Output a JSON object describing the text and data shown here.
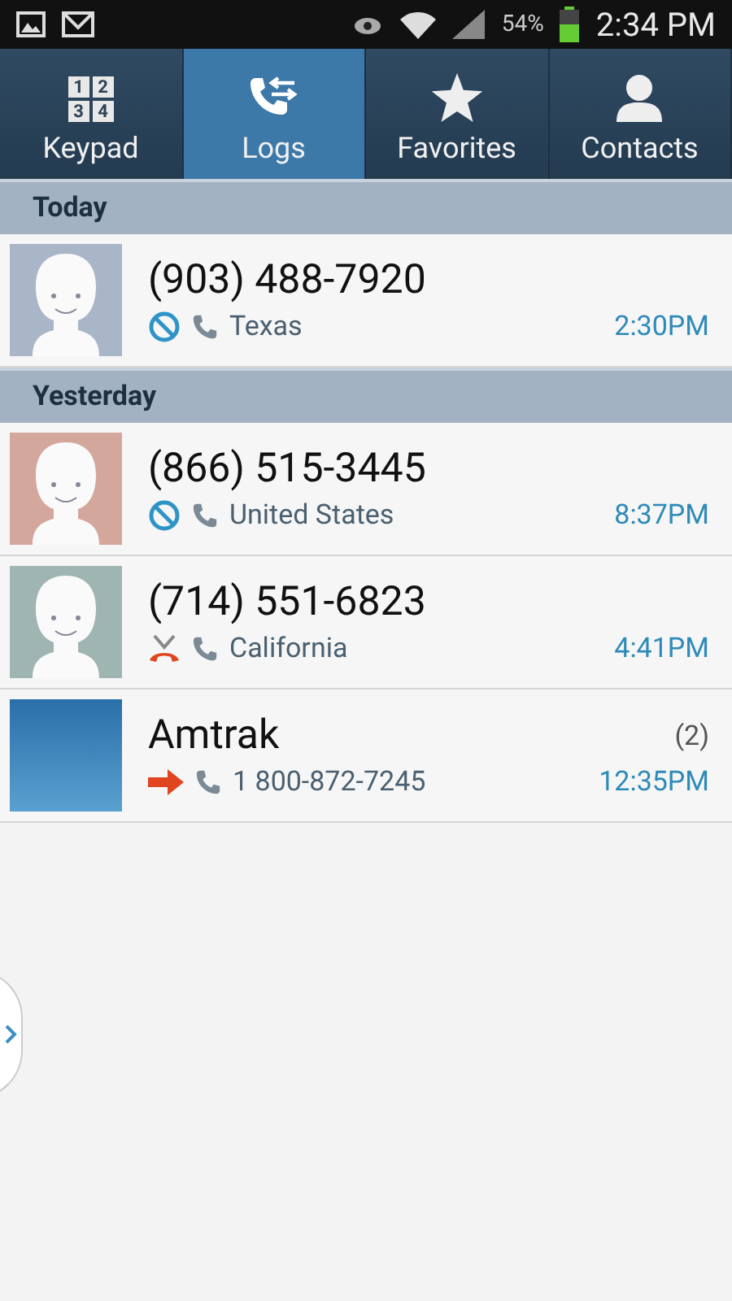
{
  "status_bar": {
    "battery_text": "54%",
    "time": "2:34 PM"
  },
  "tabs": [
    {
      "label": "Keypad",
      "selected": false,
      "kind": "keypad",
      "icon_digits": [
        "1",
        "2",
        "3",
        "4"
      ]
    },
    {
      "label": "Logs",
      "selected": true,
      "kind": "logs"
    },
    {
      "label": "Favorites",
      "selected": false,
      "kind": "star"
    },
    {
      "label": "Contacts",
      "selected": false,
      "kind": "person"
    }
  ],
  "sections": [
    {
      "title": "Today",
      "entries": [
        {
          "name": "(903) 488-7920",
          "kind": "rejected",
          "detail": "Texas",
          "time": "2:30PM",
          "avatar": {
            "kind": "default",
            "color": "#a9b6c8"
          }
        }
      ]
    },
    {
      "title": "Yesterday",
      "entries": [
        {
          "name": "(866) 515-3445",
          "kind": "rejected",
          "detail": "United States",
          "time": "8:37PM",
          "avatar": {
            "kind": "default",
            "color": "#d4a79d"
          }
        },
        {
          "name": "(714) 551-6823",
          "kind": "missed",
          "detail": "California",
          "time": "4:41PM",
          "avatar": {
            "kind": "default",
            "color": "#9fb5b1"
          }
        },
        {
          "name": "Amtrak",
          "count": "(2)",
          "kind": "outgoing",
          "detail": "1 800-872-7245",
          "time": "12:35PM",
          "avatar": {
            "kind": "photo"
          }
        }
      ]
    }
  ]
}
